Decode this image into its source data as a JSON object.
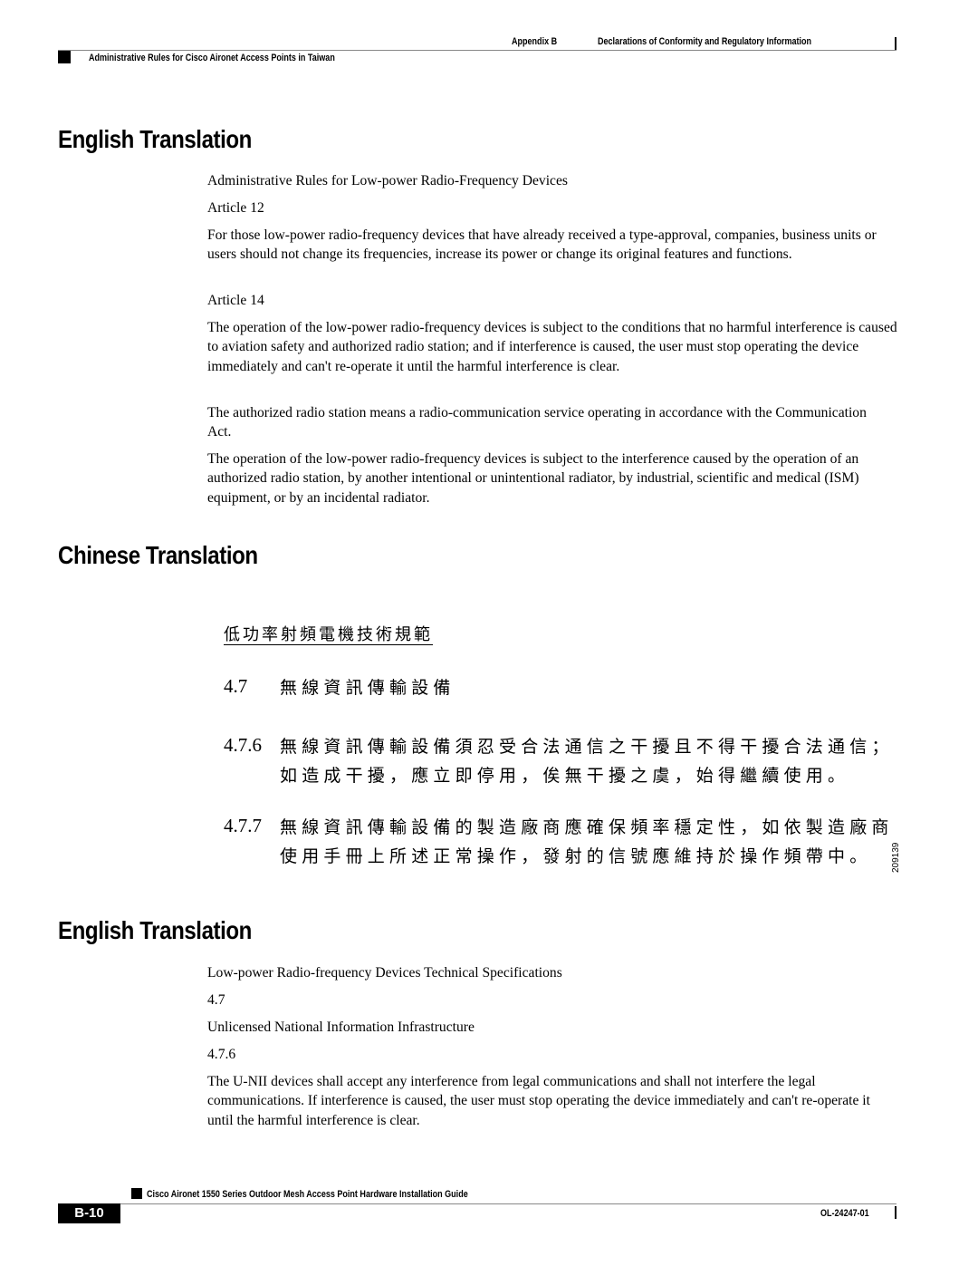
{
  "header": {
    "chapter": "Appendix B",
    "chapter_title": "Declarations of Conformity and Regulatory Information",
    "section": "Administrative Rules for Cisco Aironet Access Points in Taiwan"
  },
  "sections": {
    "english1": {
      "heading": "English Translation",
      "paragraphs": [
        "Administrative Rules for Low-power Radio-Frequency Devices",
        "Article 12",
        "For those low-power radio-frequency devices that have already received a type-approval, companies, business units or users should not change its frequencies, increase its power or change its original features and functions.",
        "Article 14",
        "The operation of the low-power radio-frequency devices is subject to the conditions that no harmful interference is caused to aviation safety and authorized radio station; and if interference is caused, the user must stop operating the device immediately and can't re-operate it until the harmful interference is clear.",
        "The authorized radio station means a radio-communication service operating in accordance with the Communication Act.",
        "The operation of the low-power radio-frequency devices is subject to the interference caused by the operation of an authorized radio station, by another intentional or unintentional radiator, by industrial, scientific and medical (ISM) equipment, or by an incidental radiator."
      ]
    },
    "chinese": {
      "heading": "Chinese Translation",
      "figure": {
        "title": "低功率射頻電機技術規範",
        "items": [
          {
            "num": "4.7",
            "lines": [
              "無線資訊傳輸設備"
            ]
          },
          {
            "num": "4.7.6",
            "lines": [
              "無線資訊傳輸設備須忍受合法通信之干擾且不得干擾合法通信；",
              "如造成干擾，應立即停用，俟無干擾之虞，始得繼續使用。"
            ]
          },
          {
            "num": "4.7.7",
            "lines": [
              "無線資訊傳輸設備的製造廠商應確保頻率穩定性，如依製造廠商",
              "使用手冊上所述正常操作，發射的信號應維持於操作頻帶中。"
            ]
          }
        ],
        "figure_id": "209139"
      }
    },
    "english2": {
      "heading": "English Translation",
      "paragraphs": [
        "Low-power Radio-frequency Devices Technical Specifications",
        "4.7",
        "Unlicensed National Information Infrastructure",
        "4.7.6",
        "The U-NII devices shall accept any interference from legal communications and shall not interfere the legal communications. If interference is caused, the user must stop operating the device immediately and can't re-operate it until the harmful interference is clear."
      ]
    }
  },
  "footer": {
    "guide_title": "Cisco Aironet 1550 Series Outdoor Mesh Access Point Hardware Installation Guide",
    "page_number": "B-10",
    "doc_number": "OL-24247-01"
  }
}
